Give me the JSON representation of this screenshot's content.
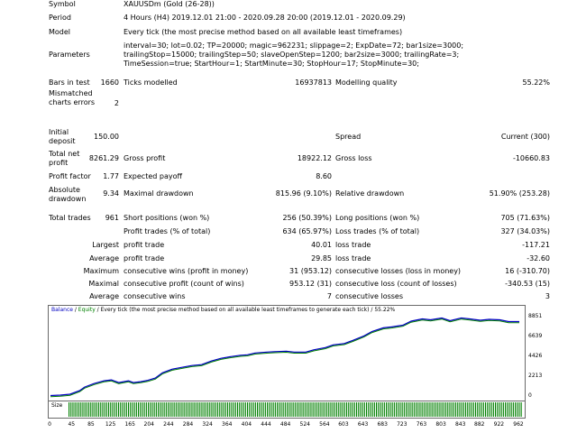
{
  "report": {
    "symbol": {
      "label": "Symbol",
      "value": "XAUUSDm (Gold (26-28))"
    },
    "period": {
      "label": "Period",
      "value": "4 Hours (H4) 2019.12.01 21:00 - 2020.09.28 20:00 (2019.12.01 - 2020.09.29)"
    },
    "model": {
      "label": "Model",
      "value": "Every tick (the most precise method based on all available least timeframes)"
    },
    "parameters": {
      "label": "Parameters",
      "value": "interval=30; lot=0.02; TP=20000; magic=962231; slippage=2; ExpDate=72; bar1size=3000; trailingStop=15000; trailingStep=50; slaveOpenStep=1200; bar2size=3000; trailingRate=3; TimeSession=true; StartHour=1; StartMinute=30; StopHour=17; StopMinute=30;"
    },
    "bars": {
      "label": "Bars in test",
      "value": "1660"
    },
    "ticks": {
      "label": "Ticks modelled",
      "value": "16937813"
    },
    "quality": {
      "label": "Modelling quality",
      "value": "55.22%"
    },
    "mismatched": {
      "label": "Mismatched charts errors",
      "value": "2"
    },
    "deposit": {
      "label": "Initial deposit",
      "value": "150.00"
    },
    "spread": {
      "label": "Spread",
      "value": "Current (300)"
    },
    "net_profit": {
      "label": "Total net profit",
      "value": "8261.29"
    },
    "gross_profit": {
      "label": "Gross profit",
      "value": "18922.12"
    },
    "gross_loss": {
      "label": "Gross loss",
      "value": "-10660.83"
    },
    "profit_factor": {
      "label": "Profit factor",
      "value": "1.77"
    },
    "expected_payoff": {
      "label": "Expected payoff",
      "value": "8.60"
    },
    "abs_dd": {
      "label": "Absolute drawdown",
      "value": "9.34"
    },
    "max_dd": {
      "label": "Maximal drawdown",
      "value": "815.96 (9.10%)"
    },
    "rel_dd": {
      "label": "Relative drawdown",
      "value": "51.90% (253.28)"
    },
    "total_trades": {
      "label": "Total trades",
      "value": "961"
    },
    "short_pos": {
      "label": "Short positions (won %)",
      "value": "256 (50.39%)"
    },
    "long_pos": {
      "label": "Long positions (won %)",
      "value": "705 (71.63%)"
    },
    "profit_trades": {
      "label": "Profit trades (% of total)",
      "value": "634 (65.97%)"
    },
    "loss_trades": {
      "label": "Loss trades (% of total)",
      "value": "327 (34.03%)"
    },
    "largest": {
      "prefix": "Largest",
      "profit_label": "profit trade",
      "profit": "40.01",
      "loss_label": "loss trade",
      "loss": "-117.21"
    },
    "average": {
      "prefix": "Average",
      "profit_label": "profit trade",
      "profit": "29.85",
      "loss_label": "loss trade",
      "loss": "-32.60"
    },
    "maximum": {
      "prefix": "Maximum",
      "wins_label": "consecutive wins (profit in money)",
      "wins": "31 (953.12)",
      "losses_label": "consecutive losses (loss in money)",
      "losses": "16 (-310.70)"
    },
    "maximal": {
      "prefix": "Maximal",
      "wins_label": "consecutive profit (count of wins)",
      "wins": "953.12 (31)",
      "losses_label": "consecutive loss (count of losses)",
      "losses": "-340.53 (15)"
    },
    "average2": {
      "prefix": "Average",
      "wins_label": "consecutive wins",
      "wins": "7",
      "losses_label": "consecutive losses",
      "losses": "3"
    }
  },
  "chart_head": {
    "balance": "Balance",
    "sep": " / ",
    "equity": "Equity",
    "rest": " / Every tick (the most precise method based on all available least timeframes to generate each tick) / 55.22%"
  },
  "size_label": "Size",
  "colors": {
    "balance": "#0000c0",
    "equity": "#008000",
    "size_bars": "#008000"
  },
  "chart_data": {
    "type": "line",
    "x_ticks": [
      "0",
      "45",
      "85",
      "125",
      "165",
      "204",
      "244",
      "284",
      "324",
      "364",
      "404",
      "444",
      "484",
      "524",
      "564",
      "603",
      "643",
      "683",
      "723",
      "763",
      "803",
      "843",
      "882",
      "922",
      "962"
    ],
    "y_ticks": [
      "8851",
      "6639",
      "4426",
      "2213",
      "0"
    ],
    "xlim": [
      0,
      962
    ],
    "ylim": [
      0,
      8851
    ],
    "series": [
      {
        "x": [
          0,
          20,
          40,
          60,
          70,
          90,
          110,
          125,
          140,
          160,
          170,
          185,
          200,
          215,
          230,
          250,
          270,
          290,
          310,
          330,
          350,
          370,
          390,
          404,
          420,
          444,
          460,
          484,
          500,
          524,
          540,
          564,
          580,
          603,
          620,
          643,
          660,
          683,
          700,
          723,
          740,
          763,
          780,
          803,
          820,
          843,
          860,
          882,
          900,
          922,
          940,
          962
        ],
        "y": [
          150,
          200,
          300,
          700,
          1100,
          1500,
          1800,
          1900,
          1600,
          1800,
          1600,
          1700,
          1850,
          2100,
          2700,
          3100,
          3300,
          3500,
          3600,
          4000,
          4300,
          4500,
          4650,
          4700,
          4900,
          5000,
          5050,
          5100,
          5000,
          5000,
          5250,
          5500,
          5800,
          5950,
          6300,
          6800,
          7300,
          7700,
          7800,
          8000,
          8450,
          8700,
          8600,
          8800,
          8500,
          8800,
          8700,
          8550,
          8650,
          8600,
          8400,
          8400
        ]
      }
    ]
  }
}
